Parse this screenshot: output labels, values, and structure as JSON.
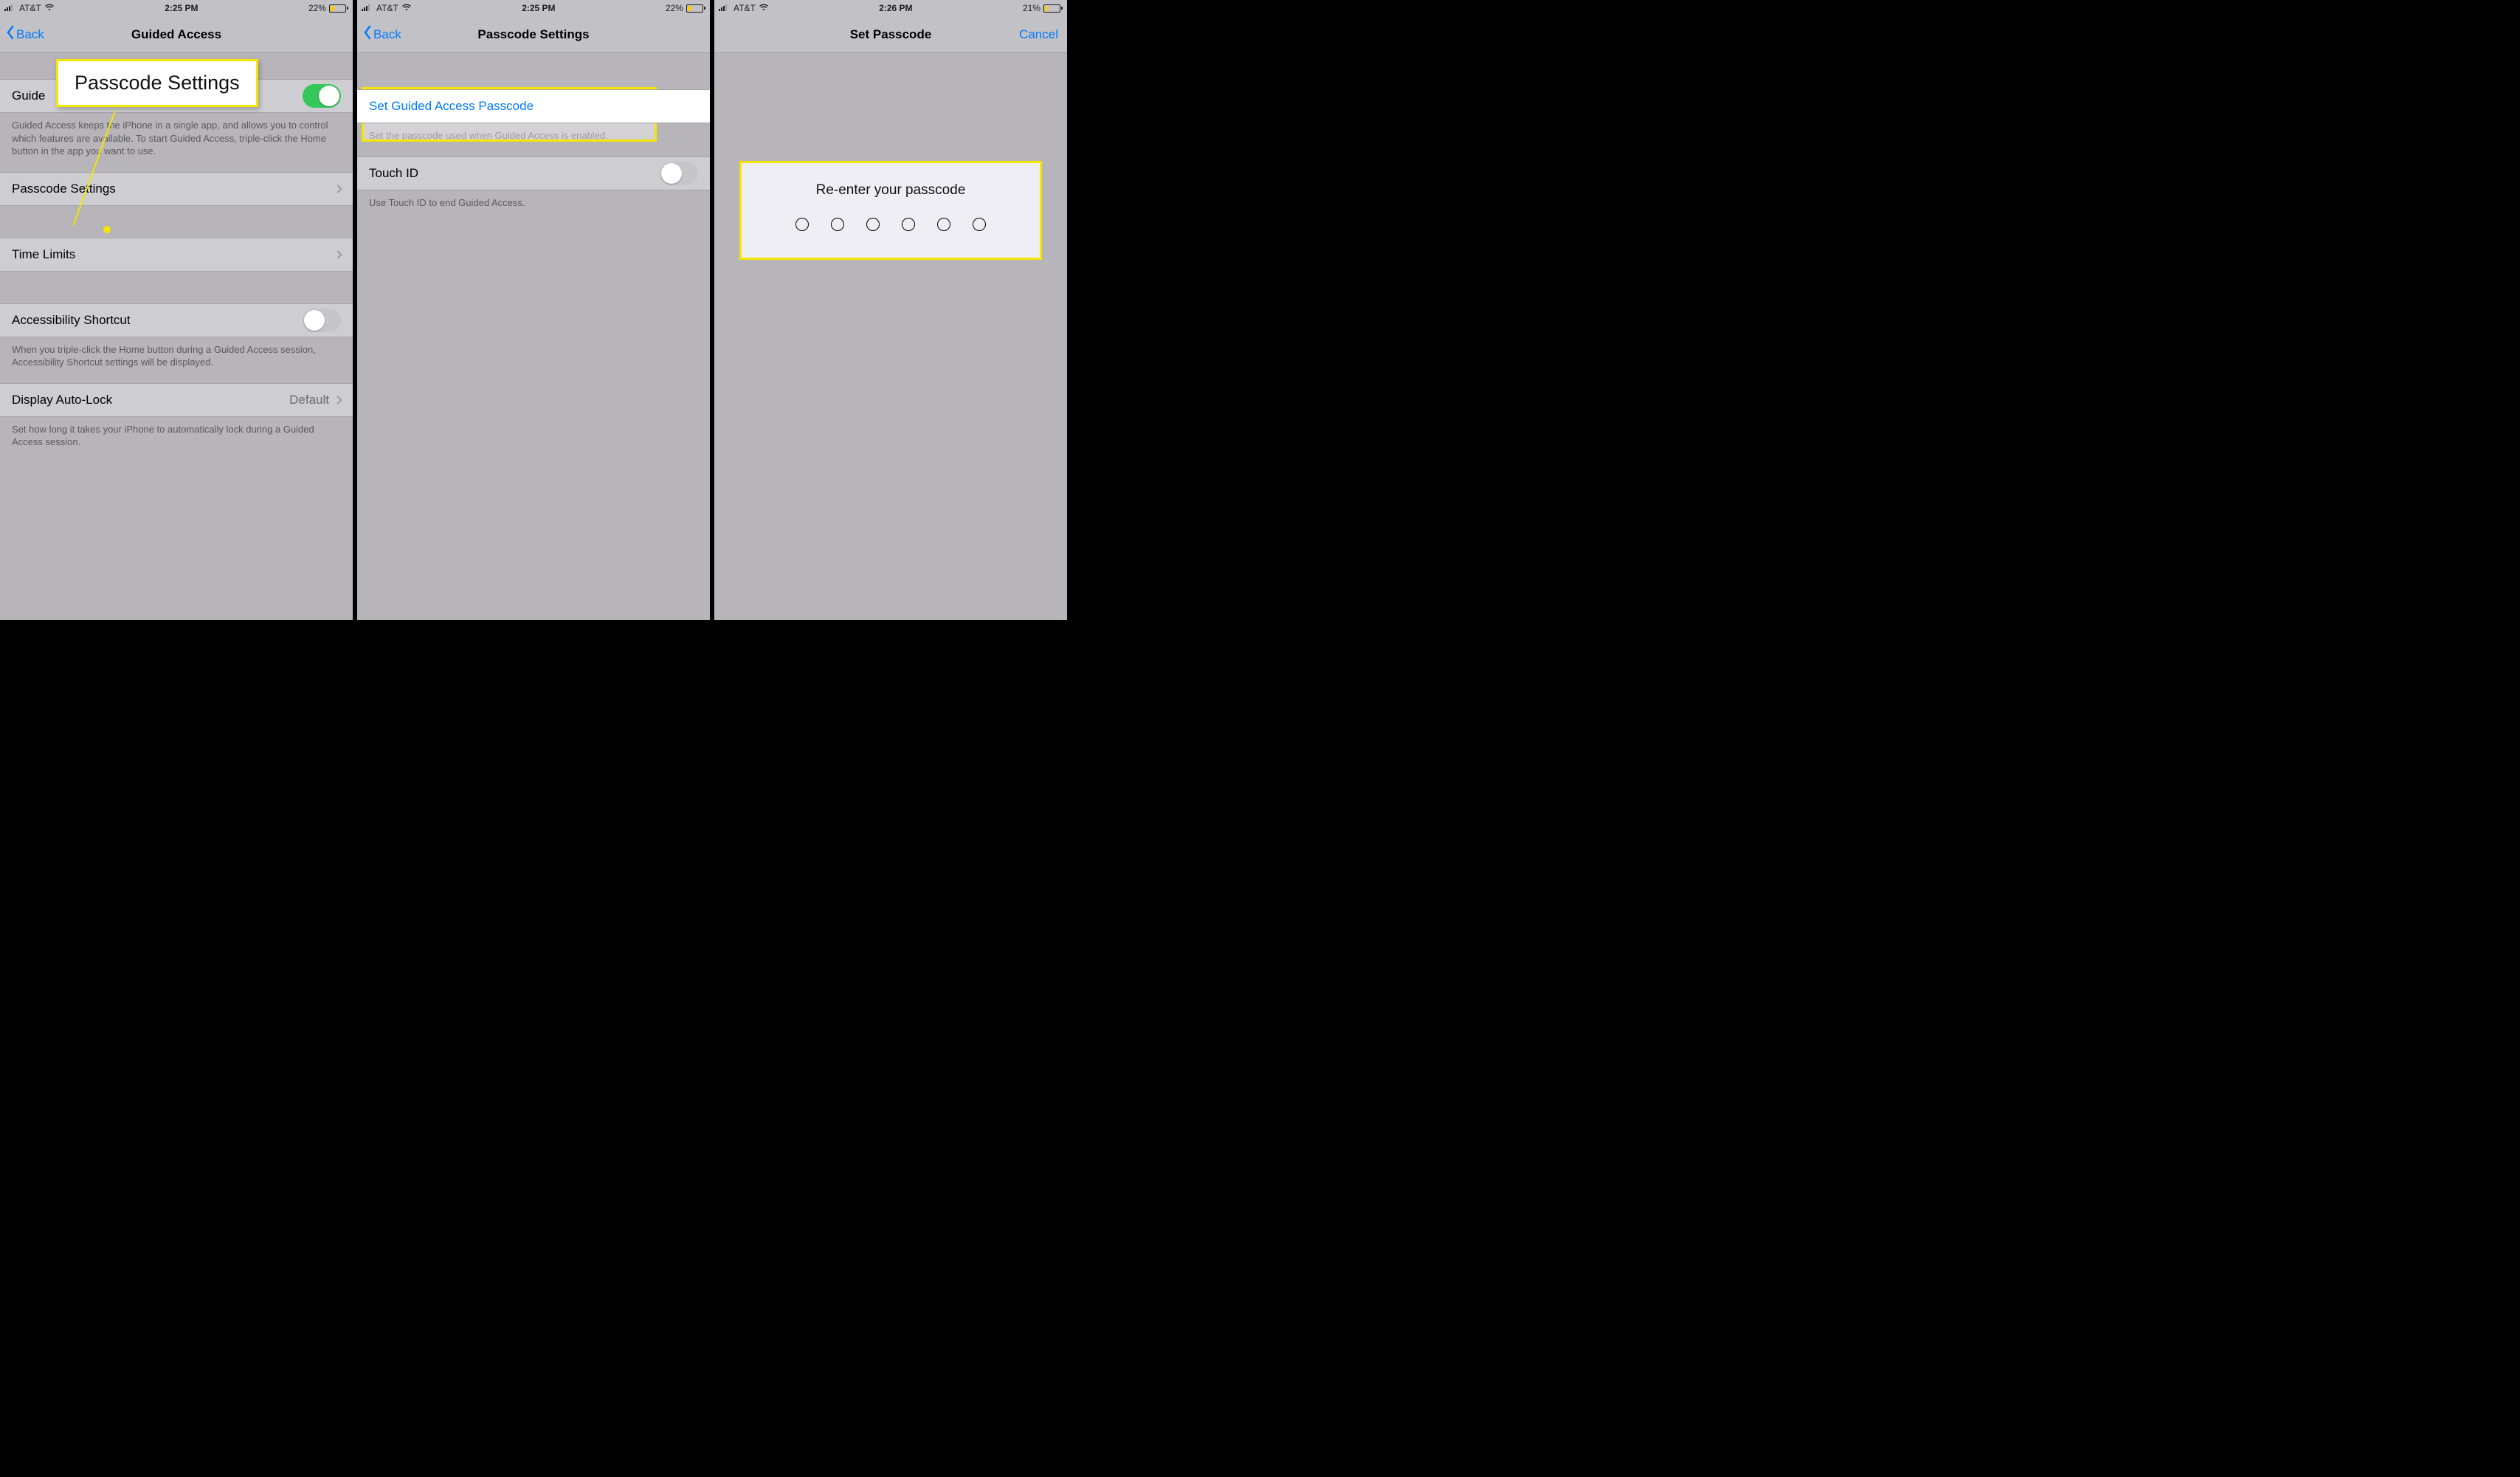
{
  "screen1": {
    "status": {
      "carrier": "AT&T",
      "time": "2:25 PM",
      "battery_pct": "22%"
    },
    "nav": {
      "back": "Back",
      "title": "Guided Access"
    },
    "callout_label": "Passcode Settings",
    "rows": {
      "guided_access_label": "Guided Access",
      "guided_access_toggle_label_partial": "Guide"
    },
    "footer1": "Guided Access keeps the iPhone in a single app, and allows you to control which features are available. To start Guided Access, triple-click the Home button in the app you want to use.",
    "passcode_settings_label": "Passcode Settings",
    "time_limits_label": "Time Limits",
    "accessibility_shortcut_label": "Accessibility Shortcut",
    "footer2": "When you triple-click the Home button during a Guided Access session, Accessibility Shortcut settings will be displayed.",
    "display_autolock_label": "Display Auto-Lock",
    "display_autolock_value": "Default",
    "footer3": "Set how long it takes your iPhone to automatically lock during a Guided Access session."
  },
  "screen2": {
    "status": {
      "carrier": "AT&T",
      "time": "2:25 PM",
      "battery_pct": "22%"
    },
    "nav": {
      "back": "Back",
      "title": "Passcode Settings"
    },
    "set_passcode_label": "Set Guided Access Passcode",
    "footer1": "Set the passcode used when Guided Access is enabled.",
    "touch_id_label": "Touch ID",
    "footer2": "Use Touch ID to end Guided Access."
  },
  "screen3": {
    "status": {
      "carrier": "AT&T",
      "time": "2:26 PM",
      "battery_pct": "21%"
    },
    "nav": {
      "title": "Set Passcode",
      "cancel": "Cancel"
    },
    "panel_title": "Re-enter your passcode",
    "dot_count": 6
  }
}
